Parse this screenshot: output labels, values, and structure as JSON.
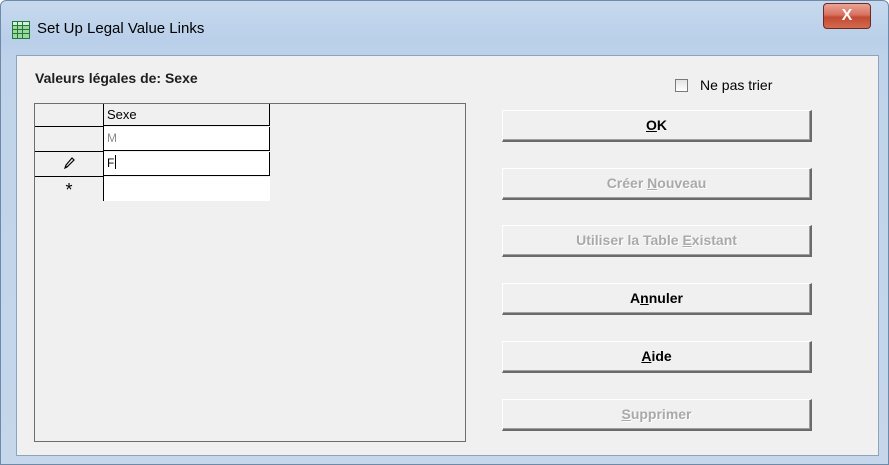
{
  "window": {
    "title": "Set Up Legal Value Links",
    "icon": "grid-app-icon",
    "close_label": "X"
  },
  "list_label": "Valeurs légales de:  Sexe",
  "grid": {
    "column_header": "Sexe",
    "rows": [
      {
        "indicator": "",
        "value": "M"
      },
      {
        "indicator": "pencil-icon",
        "value": "F"
      },
      {
        "indicator": "asterisk-icon",
        "value": ""
      }
    ],
    "new_row_symbol": "*"
  },
  "sort_checkbox": {
    "label": "Ne pas trier",
    "checked": false
  },
  "buttons": {
    "ok": {
      "pre": "",
      "accel": "O",
      "post": "K",
      "enabled": true
    },
    "create_new": {
      "pre": "Créer ",
      "accel": "N",
      "post": "ouveau",
      "enabled": false
    },
    "use_existing": {
      "pre": "Utiliser la Table ",
      "accel": "E",
      "post": "xistant",
      "enabled": false
    },
    "cancel": {
      "pre": "A",
      "accel": "n",
      "post": "nuler",
      "enabled": true
    },
    "help": {
      "pre": "",
      "accel": "A",
      "post": "ide",
      "enabled": true
    },
    "delete": {
      "pre": "",
      "accel": "S",
      "post": "upprimer",
      "enabled": false
    }
  }
}
